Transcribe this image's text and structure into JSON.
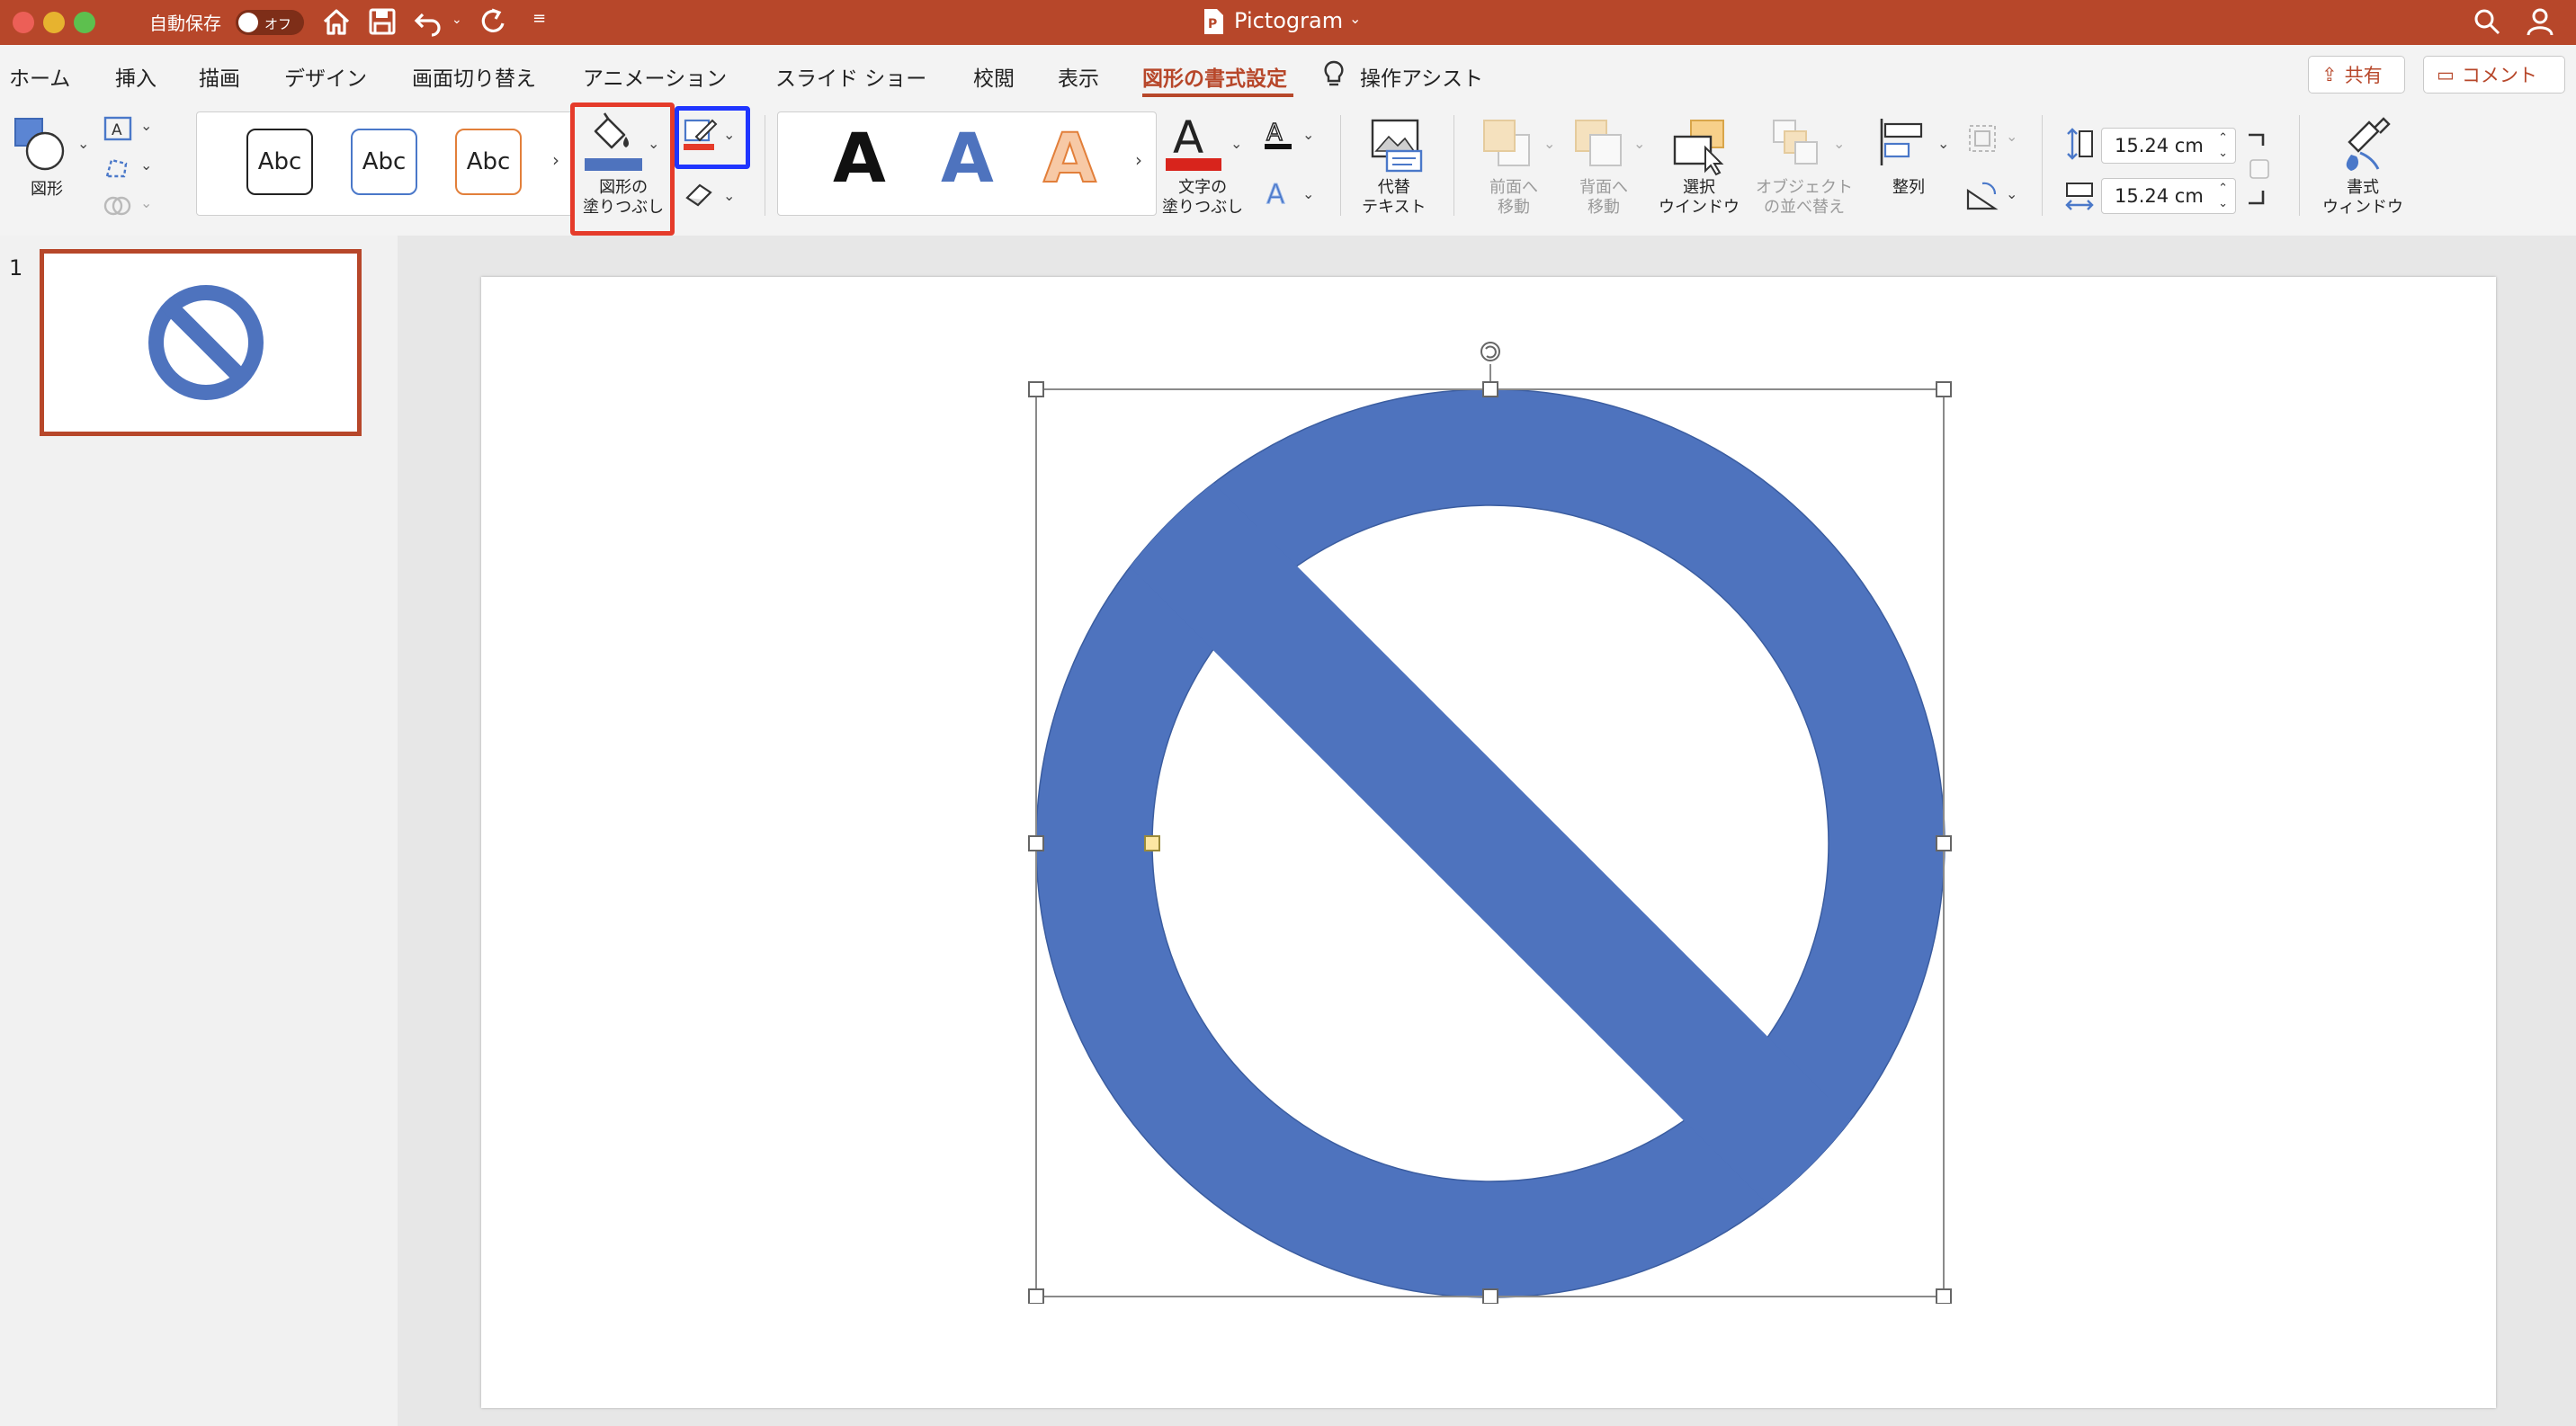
{
  "window": {
    "title": "Pictogram",
    "autosave_label": "自動保存",
    "autosave_state": "オフ"
  },
  "menu": {
    "tabs": [
      "ホーム",
      "挿入",
      "描画",
      "デザイン",
      "画面切り替え",
      "アニメーション",
      "スライド ショー",
      "校閲",
      "表示",
      "図形の書式設定"
    ],
    "active_tab": "図形の書式設定",
    "assist": "操作アシスト",
    "share": "共有",
    "comment": "コメント"
  },
  "ribbon": {
    "shapes_label": "図形",
    "style_samples": [
      "Abc",
      "Abc",
      "Abc"
    ],
    "shape_fill_line1": "図形の",
    "shape_fill_line2": "塗りつぶし",
    "wordart_samples": [
      "A",
      "A",
      "A"
    ],
    "text_fill_line1": "文字の",
    "text_fill_line2": "塗りつぶし",
    "alt_text_line1": "代替",
    "alt_text_line2": "テキスト",
    "bring_forward_line1": "前面へ",
    "bring_forward_line2": "移動",
    "send_backward_line1": "背面へ",
    "send_backward_line2": "移動",
    "selection_pane_line1": "選択",
    "selection_pane_line2": "ウインドウ",
    "reorder_line1": "オブジェクト",
    "reorder_line2": "の並べ替え",
    "align_label": "整列",
    "height_value": "15.24 cm",
    "width_value": "15.24 cm",
    "format_pane_line1": "書式",
    "format_pane_line2": "ウィンドウ"
  },
  "slides": {
    "current_number": "1"
  },
  "colors": {
    "accent": "#b7472a",
    "shape_fill": "#4e73be",
    "highlight_red": "#e53b2a",
    "highlight_blue": "#1f35ff"
  },
  "icons": {
    "home": "home-icon",
    "save": "save-icon",
    "undo": "undo-icon",
    "redo": "redo-icon",
    "search": "search-icon",
    "person": "person-icon",
    "paint_bucket": "paint-bucket-icon",
    "pen": "pen-outline-icon"
  }
}
